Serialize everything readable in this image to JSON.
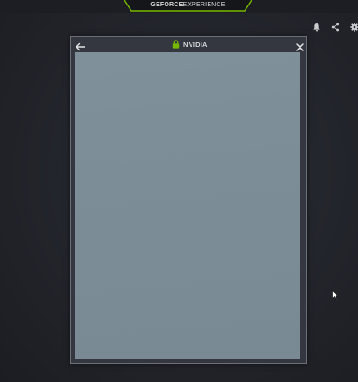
{
  "app": {
    "brand_bold": "GEFORCE",
    "brand_light": "EXPERIENCE"
  },
  "toolbar": {
    "icons": [
      "bell-icon",
      "share-icon",
      "gear-icon"
    ]
  },
  "dialog": {
    "title": "NVIDIA",
    "back_icon": "arrow-left-icon",
    "lock_icon": "lock-icon",
    "close_icon": "close-icon"
  },
  "colors": {
    "accent": "#76b900",
    "background": "#23252c",
    "dialog_border": "#6b7076",
    "content_area": "#7d8d97"
  }
}
